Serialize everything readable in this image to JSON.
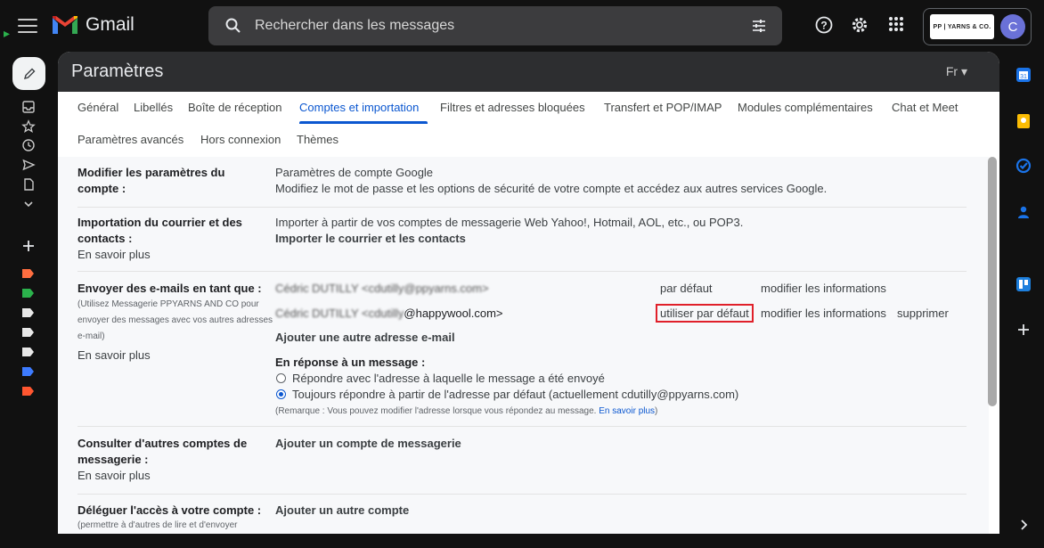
{
  "app": {
    "name": "Gmail",
    "search_placeholder": "Rechercher dans les messages",
    "account_logo_text": "PP | YARNS & CO.",
    "avatar_letter": "C"
  },
  "settings": {
    "title": "Paramètres",
    "language": "Fr ▾",
    "tabs": [
      "Général",
      "Libellés",
      "Boîte de réception",
      "Comptes et importation",
      "Filtres et adresses bloquées",
      "Transfert et POP/IMAP",
      "Modules complémentaires",
      "Chat et Meet",
      "Paramètres avancés",
      "Hors connexion",
      "Thèmes"
    ],
    "active_tab": "Comptes et importation"
  },
  "rows": {
    "account": {
      "label": "Modifier les paramètres du compte :",
      "link": "Paramètres de compte Google",
      "desc": "Modifiez le mot de passe et les options de sécurité de votre compte et accédez aux autres services Google."
    },
    "import": {
      "label": "Importation du courrier et des contacts :",
      "learn_more": "En savoir plus",
      "desc": "Importer à partir de vos comptes de messagerie Web Yahoo!, Hotmail, AOL, etc., ou POP3.",
      "action": "Importer le courrier et les contacts"
    },
    "send_as": {
      "label": "Envoyer des e-mails en tant que :",
      "note": "(Utilisez Messagerie PPYARNS AND CO pour envoyer des messages avec vos autres adresses e-mail)",
      "learn_more": "En savoir plus",
      "addresses": [
        {
          "address": "Cédric DUTILLY <cdutilly@ppyarns.com>",
          "status": "par défaut",
          "edit": "modifier les informations"
        },
        {
          "address_hidden": "Cédric DUTILLY <cdutilly",
          "address_visible": "@happywool.com>",
          "make_default": "utiliser par défaut",
          "edit": "modifier les informations",
          "delete": "supprimer"
        }
      ],
      "add_address": "Ajouter une autre adresse e-mail",
      "reply_heading": "En réponse à un message :",
      "reply_options": [
        "Répondre avec l'adresse à laquelle le message a été envoyé",
        "Toujours répondre à partir de l'adresse par défaut (actuellement cdutilly@ppyarns.com)"
      ],
      "reply_selected": 1,
      "remark": "(Remarque : Vous pouvez modifier l'adresse lorsque vous répondez au message.",
      "remark_link": "En savoir plus",
      "remark_end": ")"
    },
    "other_accounts": {
      "label": "Consulter d'autres comptes de messagerie :",
      "learn_more": "En savoir plus",
      "action": "Ajouter un compte de messagerie"
    },
    "delegate": {
      "label": "Déléguer l'accès à votre compte :",
      "note": "(permettre à d'autres de lire et d'envoyer",
      "action": "Ajouter un autre compte"
    }
  },
  "colors": {
    "link": "#0b57d0",
    "highlight_box": "#e0202a",
    "labels": [
      "#ff6e40",
      "#2bb24c",
      "#e8e8e8",
      "#e8e8e8",
      "#e8e8e8",
      "#e8e8e8",
      "#3d7bff",
      "#ff5630"
    ]
  }
}
